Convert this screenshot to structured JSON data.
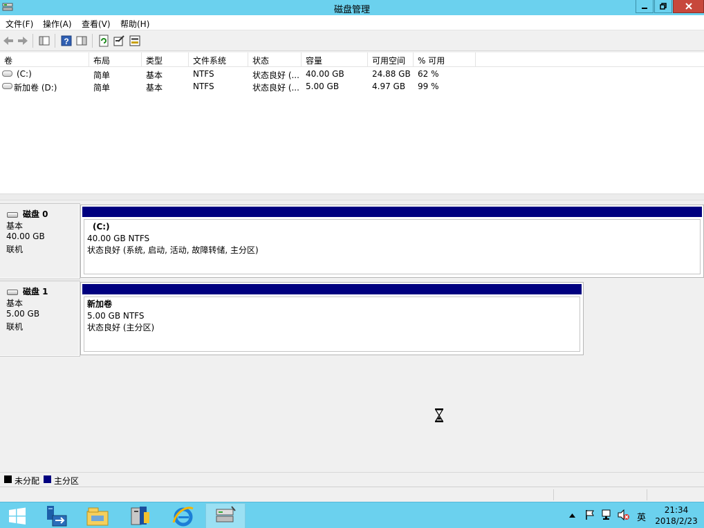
{
  "window": {
    "title": "磁盘管理",
    "accent": "#6bd1ee"
  },
  "menu": {
    "items": [
      "文件(F)",
      "操作(A)",
      "查看(V)",
      "帮助(H)"
    ]
  },
  "toolbar": {
    "icons": [
      "back-arrow-icon",
      "forward-arrow-icon",
      "console-tree-icon",
      "help-icon",
      "properties-pane-icon",
      "refresh-icon",
      "settings-icon",
      "rescan-disks-icon"
    ]
  },
  "volume_list": {
    "columns": [
      "卷",
      "布局",
      "类型",
      "文件系统",
      "状态",
      "容量",
      "可用空间",
      "% 可用"
    ],
    "rows": [
      {
        "volume": "(C:)",
        "layout": "简单",
        "type": "基本",
        "fs": "NTFS",
        "status": "状态良好 (...",
        "capacity": "40.00 GB",
        "free": "24.88 GB",
        "pct": "62 %"
      },
      {
        "volume": "新加卷 (D:)",
        "layout": "简单",
        "type": "基本",
        "fs": "NTFS",
        "status": "状态良好 (...",
        "capacity": "5.00 GB",
        "free": "4.97 GB",
        "pct": "99 %"
      }
    ]
  },
  "disks": [
    {
      "name": "磁盘 0",
      "type": "基本",
      "size": "40.00 GB",
      "state": "联机",
      "partition": {
        "name": "(C:)",
        "size_fs": "40.00 GB NTFS",
        "status": "状态良好 (系统, 启动, 活动, 故障转储, 主分区)"
      }
    },
    {
      "name": "磁盘 1",
      "type": "基本",
      "size": "5.00 GB",
      "state": "联机",
      "partition": {
        "name": "新加卷",
        "size_fs": "5.00 GB NTFS",
        "status": "状态良好 (主分区)"
      }
    }
  ],
  "legend": {
    "unallocated": "未分配",
    "primary": "主分区",
    "unallocated_color": "#000000",
    "primary_color": "#00007f"
  },
  "taskbar": {
    "buttons": [
      "start-icon",
      "server-manager-icon",
      "file-explorer-icon",
      "powershell-icon",
      "internet-explorer-icon",
      "disk-management-icon"
    ],
    "ime": "英",
    "time": "21:34",
    "date": "2018/2/23"
  }
}
